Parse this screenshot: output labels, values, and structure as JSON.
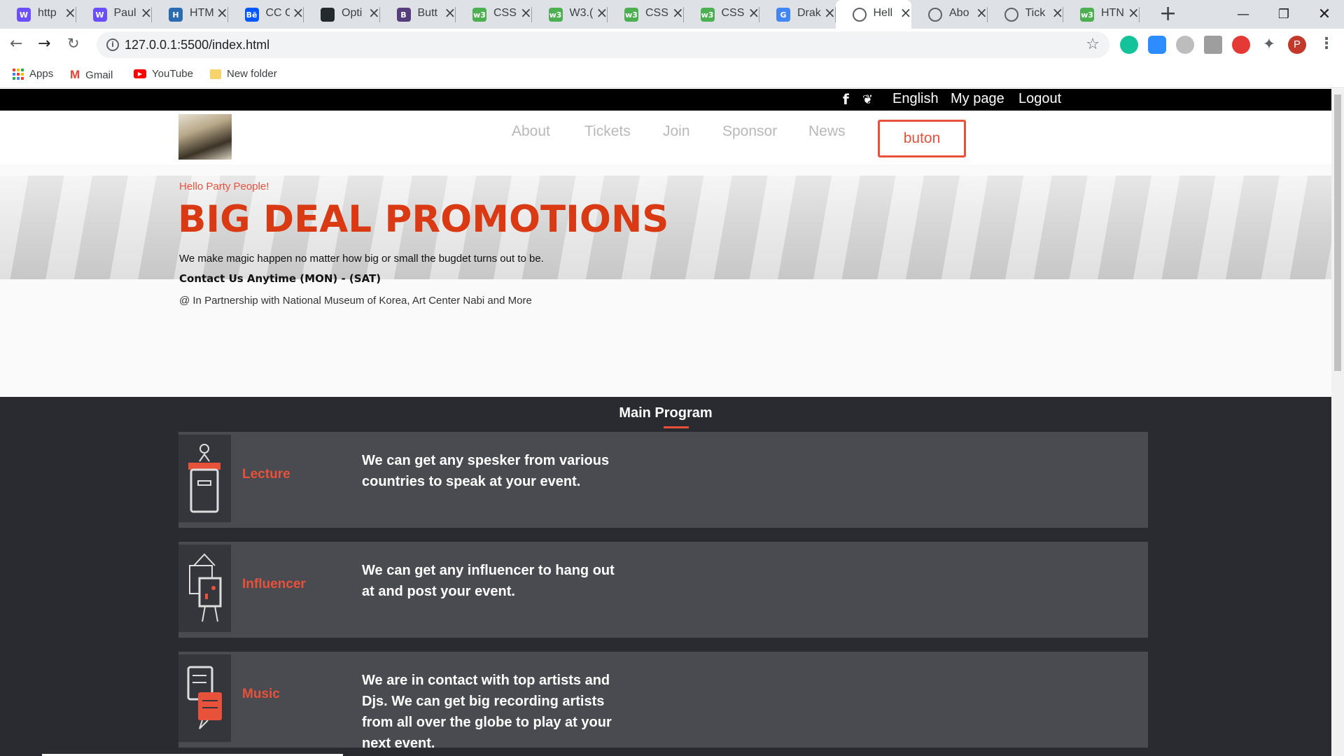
{
  "browser": {
    "tabs": [
      {
        "label": "http",
        "favicon": "W",
        "color": "#6b4eff"
      },
      {
        "label": "Paul",
        "favicon": "W",
        "color": "#6b4eff"
      },
      {
        "label": "HTM",
        "favicon": "H",
        "color": "#2b6cb0"
      },
      {
        "label": "CC C",
        "favicon": "Bē",
        "color": "#0057ff"
      },
      {
        "label": "Opti",
        "favicon": "gh",
        "color": "#24292e"
      },
      {
        "label": "Butt",
        "favicon": "B",
        "color": "#563d7c"
      },
      {
        "label": "CSS",
        "favicon": "w3",
        "color": "#4caf50"
      },
      {
        "label": "W3.(",
        "favicon": "w3",
        "color": "#4caf50"
      },
      {
        "label": "CSS",
        "favicon": "w3",
        "color": "#4caf50"
      },
      {
        "label": "CSS",
        "favicon": "w3",
        "color": "#4caf50"
      },
      {
        "label": "Drak",
        "favicon": "G",
        "color": "#4285f4"
      },
      {
        "label": "Hell",
        "favicon": "globe",
        "color": "#5f6368",
        "active": true
      },
      {
        "label": "Abo",
        "favicon": "globe",
        "color": "#5f6368"
      },
      {
        "label": "Tick",
        "favicon": "globe",
        "color": "#5f6368"
      },
      {
        "label": "HTN",
        "favicon": "w3",
        "color": "#4caf50"
      }
    ],
    "url": "127.0.0.1:5500/index.html",
    "profile_initial": "P",
    "bookmarks": [
      {
        "label": "Apps",
        "icon": "apps-grid-icon"
      },
      {
        "label": "Gmail",
        "icon": "gmail-icon"
      },
      {
        "label": "YouTube",
        "icon": "youtube-icon"
      },
      {
        "label": "New folder",
        "icon": "folder-icon"
      }
    ]
  },
  "site": {
    "topbar": {
      "language": "English",
      "mypage": "My page",
      "logout": "Logout"
    },
    "nav": [
      "About",
      "Tickets",
      "Join",
      "Sponsor",
      "News"
    ],
    "button_label": "buton",
    "hero": {
      "greeting": "Hello Party People!",
      "title": "BIG DEAL PROMOTIONS",
      "tagline": "We make magic happen no matter how big or small the bugdet turns out to be.",
      "contact": "Contact Us Anytime (MON) - (SAT)",
      "partnership": "@ In Partnership with National Museum of Korea, Art Center Nabi and More"
    },
    "program": {
      "title": "Main Program",
      "items": [
        {
          "title": "Lecture",
          "desc": "We can get any spesker from various countries to speak at your event.",
          "icon": "podium-icon"
        },
        {
          "title": "Influencer",
          "desc": "We can get any influencer to hang out at and post your event.",
          "icon": "easel-icon"
        },
        {
          "title": "Music",
          "desc": "We are in contact with top artists and Djs. We can get big recording artists from all over the globe to play at your next event.",
          "icon": "chat-bubbles-icon"
        }
      ]
    },
    "accent": "#e8513a",
    "title_color": "#d93a14"
  }
}
